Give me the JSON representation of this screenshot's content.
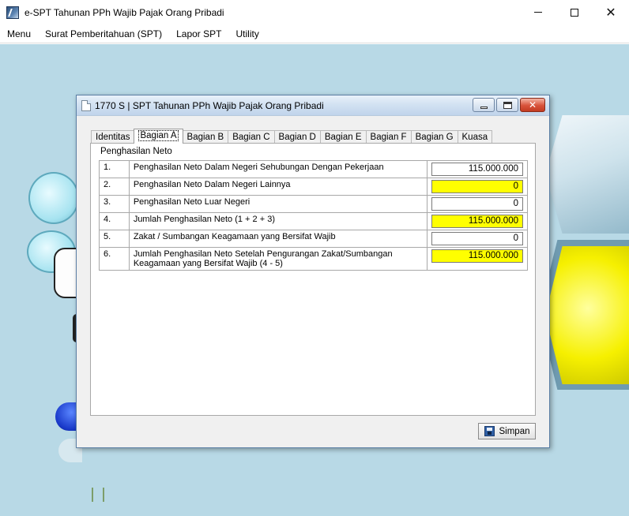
{
  "app": {
    "title": "e-SPT Tahunan PPh Wajib Pajak Orang Pribadi"
  },
  "menubar": {
    "items": [
      "Menu",
      "Surat Pemberitahuan (SPT)",
      "Lapor SPT",
      "Utility"
    ]
  },
  "dialog": {
    "title": "1770 S | SPT Tahunan PPh Wajib Pajak Orang Pribadi",
    "tabs": [
      "Identitas",
      "Bagian A",
      "Bagian B",
      "Bagian C",
      "Bagian D",
      "Bagian E",
      "Bagian F",
      "Bagian G",
      "Kuasa"
    ],
    "active_tab": "Bagian A",
    "section_title": "Penghasilan Neto",
    "rows": [
      {
        "num": "1.",
        "desc": "Penghasilan Neto Dalam Negeri Sehubungan Dengan Pekerjaan",
        "value": "115.000.000",
        "highlight": false
      },
      {
        "num": "2.",
        "desc": "Penghasilan Neto Dalam Negeri Lainnya",
        "value": "0",
        "highlight": true
      },
      {
        "num": "3.",
        "desc": "Penghasilan Neto Luar Negeri",
        "value": "0",
        "highlight": false
      },
      {
        "num": "4.",
        "desc": "Jumlah Penghasilan Neto (1 + 2 + 3)",
        "value": "115.000.000",
        "highlight": true
      },
      {
        "num": "5.",
        "desc": "Zakat / Sumbangan Keagamaan yang Bersifat Wajib",
        "value": "0",
        "highlight": false
      },
      {
        "num": "6.",
        "desc": "Jumlah Penghasilan Neto Setelah Pengurangan Zakat/Sumbangan Keagamaan yang Bersifat Wajib (4 - 5)",
        "value": "115.000.000",
        "highlight": true
      }
    ],
    "save_label": "Simpan"
  },
  "colors": {
    "highlight_field": "#ffff00",
    "workspace_bg": "#b8d9e6"
  },
  "icons": {
    "app": "app-icon",
    "dialog": "document-icon",
    "save": "floppy-disk-icon"
  }
}
